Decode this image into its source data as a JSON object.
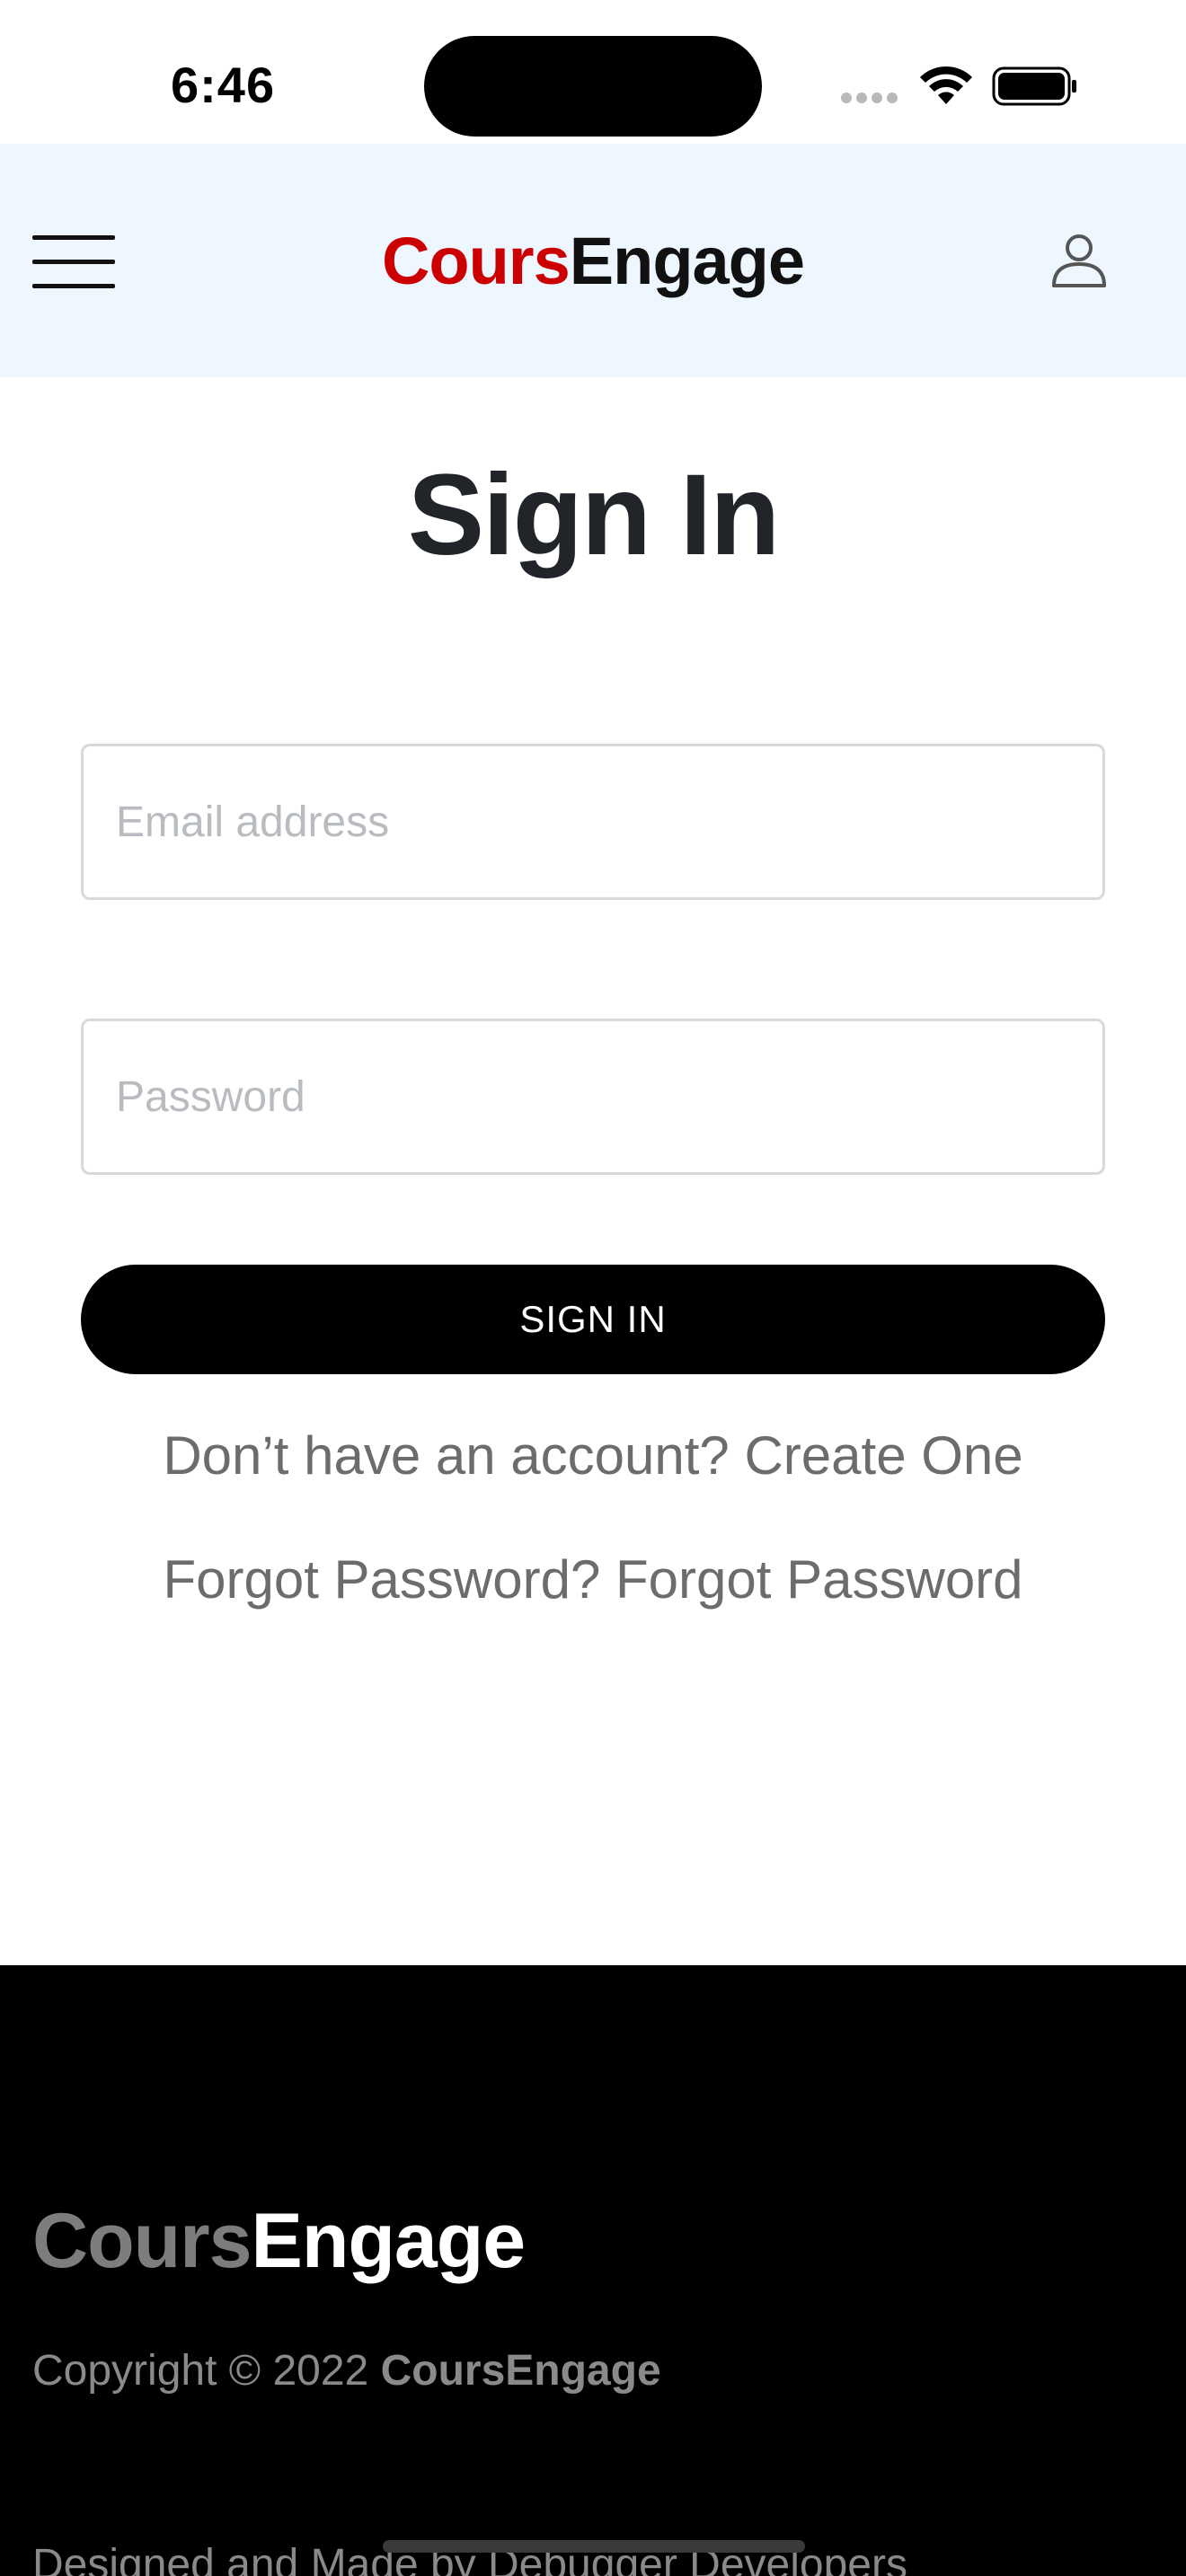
{
  "status_bar": {
    "time": "6:46",
    "icons": [
      "signal-icon",
      "wifi-icon",
      "battery-icon"
    ]
  },
  "header": {
    "menu_icon": "hamburger-menu-icon",
    "brand_part1": "Cours",
    "brand_part2": "Engage",
    "user_icon": "user-icon",
    "brand_colors": {
      "accent": "#cc0000",
      "dark": "#111111"
    },
    "background": "#eef6ff"
  },
  "main": {
    "title": "Sign In",
    "email_placeholder": "Email address",
    "email_value": "",
    "password_placeholder": "Password",
    "password_value": "",
    "submit_label": "SIGN IN",
    "account_prompt": "Don’t have an account?",
    "account_link": "Create One",
    "forgot_prompt": "Forgot Password?",
    "forgot_link": "Forgot Password"
  },
  "footer": {
    "brand_part1": "Cours",
    "brand_part2": "Engage",
    "copyright_prefix": "Copyright © 2022",
    "copyright_brand": "CoursEngage",
    "designed_by": "Designed and Made by Debugger Developers"
  }
}
